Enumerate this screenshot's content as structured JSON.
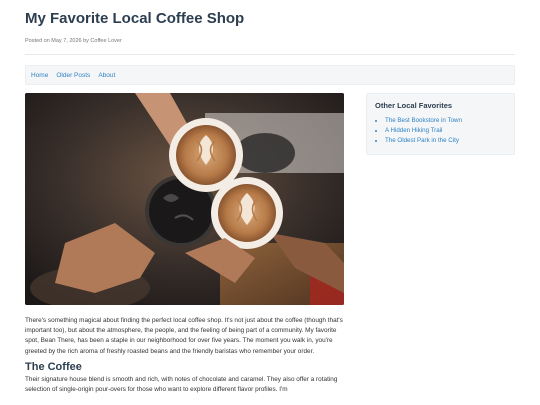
{
  "site": {
    "title": "My Favorite Local Coffee Shop",
    "meta": "Posted on May 7, 2026 by Coffee Lover"
  },
  "nav": {
    "items": [
      "Home",
      "Older Posts",
      "About"
    ]
  },
  "hero": {
    "icon": "coffee-cheers-photo"
  },
  "article": {
    "intro": "There's something magical about finding the perfect local coffee shop. It's not just about the coffee (though that's important too), but about the atmosphere, the people, and the feeling of being part of a community. My favorite spot, Bean There, has been a staple in our neighborhood for over five years. The moment you walk in, you're greeted by the rich aroma of freshly roasted beans and the friendly baristas who remember your order.",
    "section_heading": "The Coffee",
    "section_text": "Their signature house blend is smooth and rich, with notes of chocolate and caramel. They also offer a rotating selection of single-origin pour-overs for those who want to explore different flavor profiles. I'm"
  },
  "sidebar": {
    "title": "Other Local Favorites",
    "links": [
      "The Best Bookstore in Town",
      "A Hidden Hiking Trail",
      "The Oldest Park in the City"
    ]
  }
}
